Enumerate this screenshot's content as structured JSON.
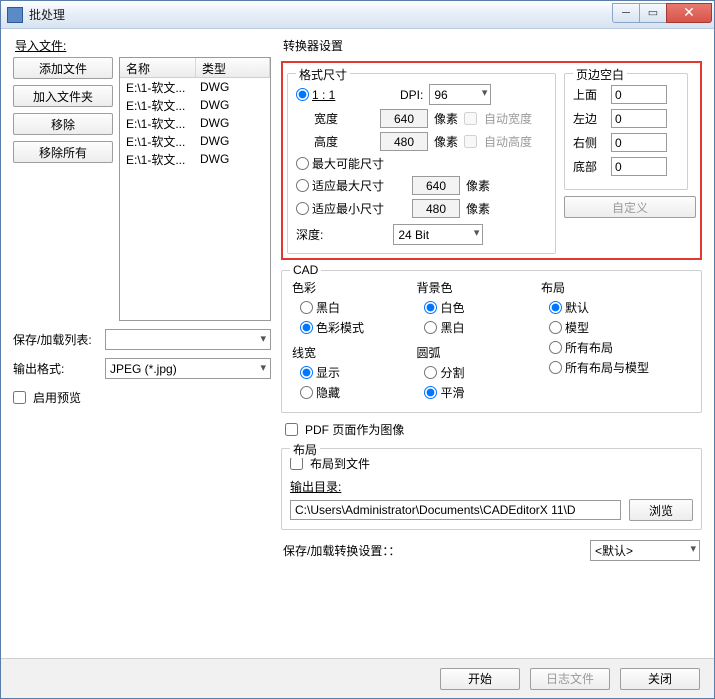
{
  "window": {
    "title": "批处理"
  },
  "left": {
    "import_label": "导入文件:",
    "add_file": "添加文件",
    "add_folder": "加入文件夹",
    "remove": "移除",
    "remove_all": "移除所有",
    "col_name": "名称",
    "col_type": "类型",
    "files": [
      {
        "name": "E:\\1-软文...",
        "type": "DWG"
      },
      {
        "name": "E:\\1-软文...",
        "type": "DWG"
      },
      {
        "name": "E:\\1-软文...",
        "type": "DWG"
      },
      {
        "name": "E:\\1-软文...",
        "type": "DWG"
      },
      {
        "name": "E:\\1-软文...",
        "type": "DWG"
      }
    ],
    "save_list_label": "保存/加载列表:",
    "save_list_value": "",
    "out_fmt_label": "输出格式:",
    "out_fmt_value": "JPEG (*.jpg)",
    "preview_label": "启用预览"
  },
  "conv": {
    "title": "转换器设置",
    "fmt_title": "格式尺寸",
    "margin_title": "页边空白",
    "r_1_1": "1 : 1",
    "dpi_label": "DPI:",
    "dpi_value": "96",
    "width_label": "宽度",
    "width_value": "640",
    "height_label": "高度",
    "height_value": "480",
    "px": "像素",
    "auto_w": "自动宽度",
    "auto_h": "自动高度",
    "r_max": "最大可能尺寸",
    "r_fit_max": "适应最大尺寸",
    "fit_max_value": "640",
    "r_fit_min": "适应最小尺寸",
    "fit_min_value": "480",
    "depth_label": "深度:",
    "depth_value": "24 Bit",
    "m_top": "上面",
    "m_top_v": "0",
    "m_left": "左边",
    "m_left_v": "0",
    "m_right": "右侧",
    "m_right_v": "0",
    "m_bottom": "底部",
    "m_bottom_v": "0",
    "custom_btn": "自定义"
  },
  "cad": {
    "title": "CAD",
    "color": "色彩",
    "bw": "黑白",
    "cmode": "色彩模式",
    "bg": "背景色",
    "white": "白色",
    "black": "黑白",
    "layout": "布局",
    "def": "默认",
    "model": "模型",
    "all": "所有布局",
    "allm": "所有布局与模型",
    "lw": "线宽",
    "show": "显示",
    "hide": "隐藏",
    "arc": "圆弧",
    "split": "分割",
    "smooth": "平滑"
  },
  "pdf_as_image": "PDF 页面作为图像",
  "lay": {
    "title": "布局",
    "to_file": "布局到文件",
    "outdir_label": "输出目录:",
    "outdir": "C:\\Users\\Administrator\\Documents\\CADEditorX 11\\D",
    "browse": "浏览"
  },
  "save_conv": {
    "label": "保存/加载转换设置：：",
    "value": "<默认>"
  },
  "dlg": {
    "start": "开始",
    "log": "日志文件",
    "close": "关闭"
  }
}
